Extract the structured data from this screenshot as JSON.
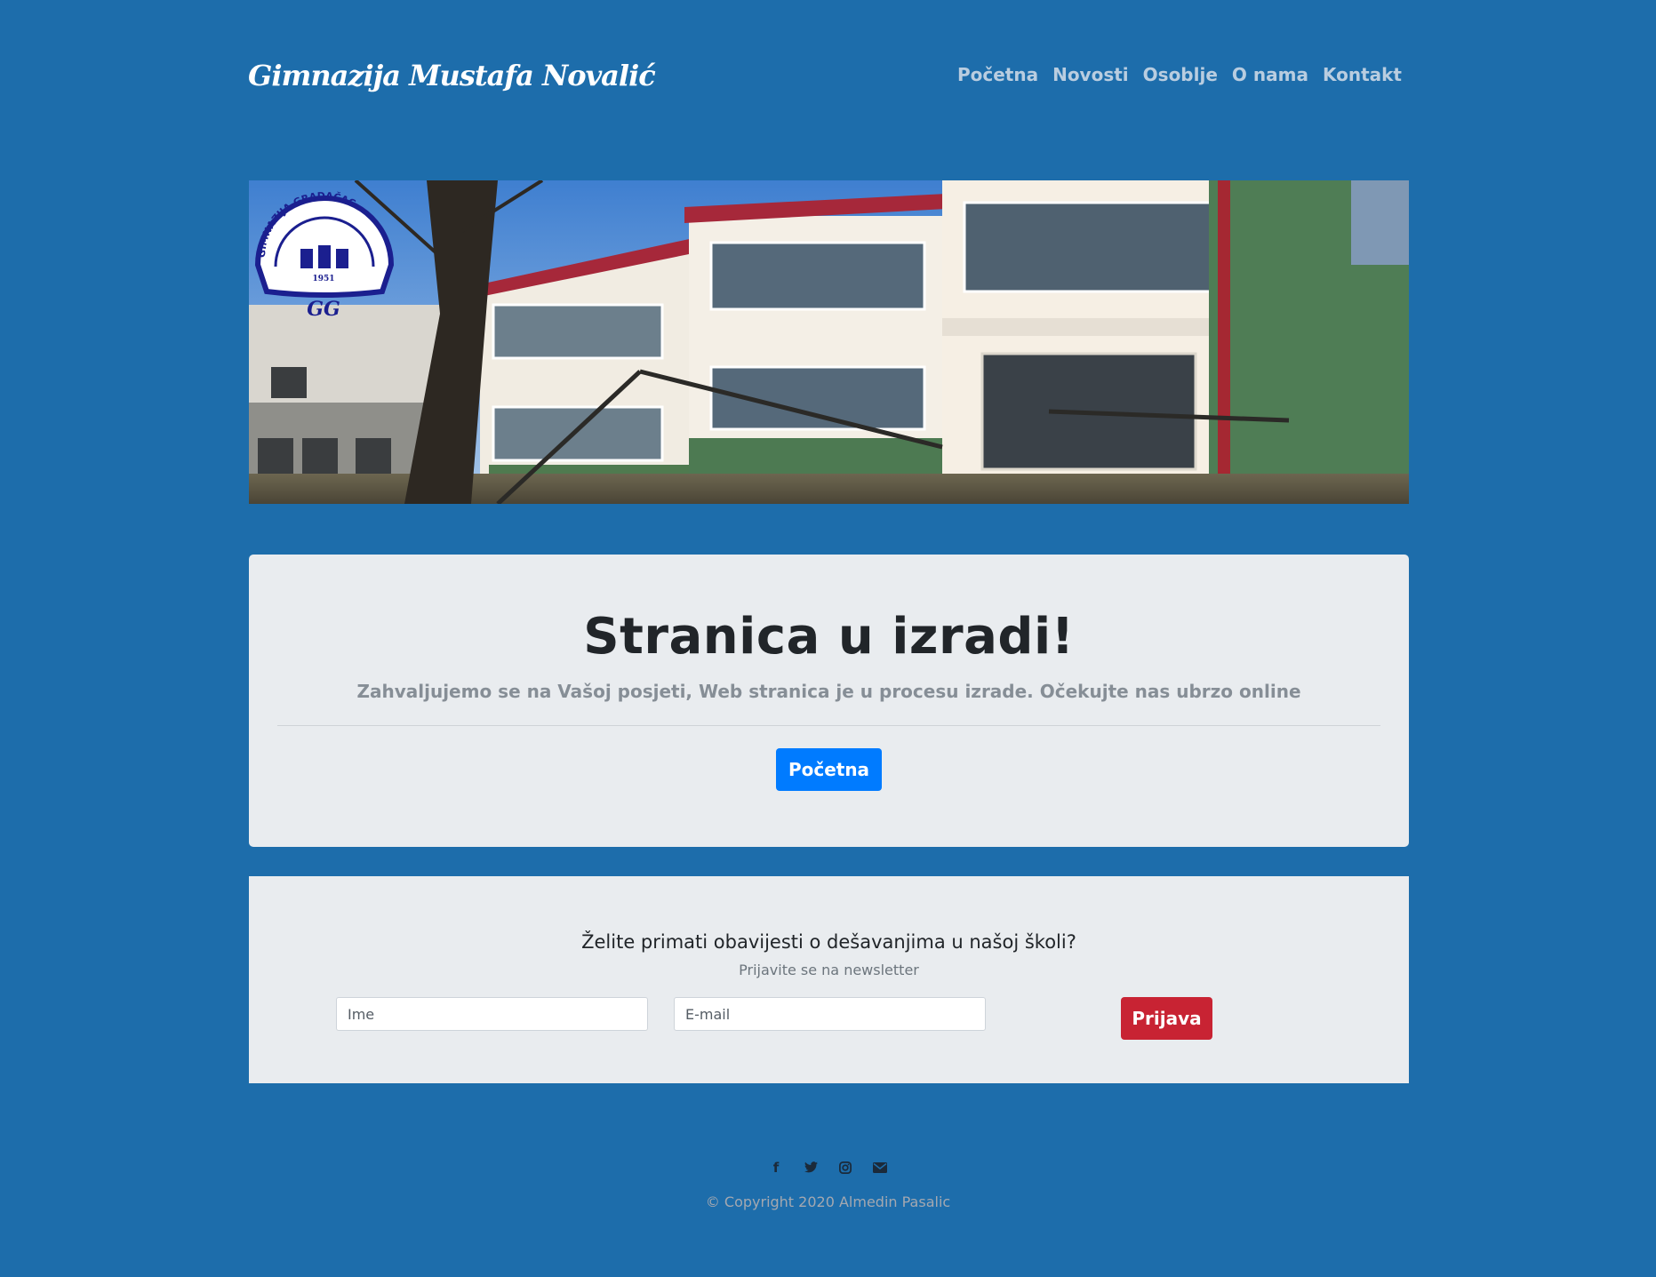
{
  "header": {
    "brand": "Gimnazija Mustafa Novalić",
    "nav": [
      "Početna",
      "Novosti",
      "Osoblje",
      "O nama",
      "Kontakt"
    ]
  },
  "hero": {
    "logo_text_top": "GIMNAZIJA GRADAČAC",
    "logo_year": "1951",
    "logo_mark": "GG"
  },
  "jumbotron": {
    "title": "Stranica u izradi!",
    "lead": "Zahvaljujemo se na Vašoj posjeti, Web stranica je u procesu izrade. Očekujte nas ubrzo online",
    "button_label": "Početna"
  },
  "newsletter": {
    "title": "Želite primati obavijesti o dešavanjima u našoj školi?",
    "subtitle": "Prijavite se na newsletter",
    "name_placeholder": "Ime",
    "email_placeholder": "E-mail",
    "submit_label": "Prijava"
  },
  "footer": {
    "social_icons": [
      "facebook-icon",
      "twitter-icon",
      "instagram-icon",
      "email-icon"
    ],
    "copyright": "© Copyright 2020 Almedin Pasalic"
  },
  "colors": {
    "background": "#1d6dab",
    "primary": "#007bff",
    "danger": "#c82333",
    "panel": "#e9ecef"
  }
}
